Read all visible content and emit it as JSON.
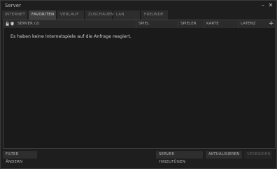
{
  "window": {
    "title": "Server",
    "minimize_glyph": "–",
    "close_glyph": "✕"
  },
  "tabs": [
    {
      "label": "INTERNET",
      "active": false
    },
    {
      "label": "FAVORITEN",
      "active": true
    },
    {
      "label": "VERLAUF",
      "active": false
    },
    {
      "label": "ZUSCHAUEN",
      "active": false
    },
    {
      "label": "LAN",
      "active": false
    },
    {
      "label": "FREUNDE",
      "active": false
    }
  ],
  "table": {
    "columns": {
      "server": "SERVER (2)",
      "game": "SPIEL",
      "players": "SPIELER",
      "map": "KARTE",
      "latency": "LATENZ"
    },
    "add_glyph": "+",
    "icons": [
      "lock-icon",
      "shield-icon"
    ],
    "empty_message": "Es haben keine Internetspiele auf die Anfrage reagiert."
  },
  "buttons": {
    "filter": "FILTER ÄNDERN",
    "add_server": "SERVER HINZUFÜGEN",
    "refresh": "AKTUALISIEREN",
    "connect": "VERBINDEN"
  },
  "colors": {
    "background": "#1e1e1e",
    "active_tab": "#3f3f3f",
    "inactive_tab": "#2d2d2d",
    "text": "#cfcfcf"
  }
}
